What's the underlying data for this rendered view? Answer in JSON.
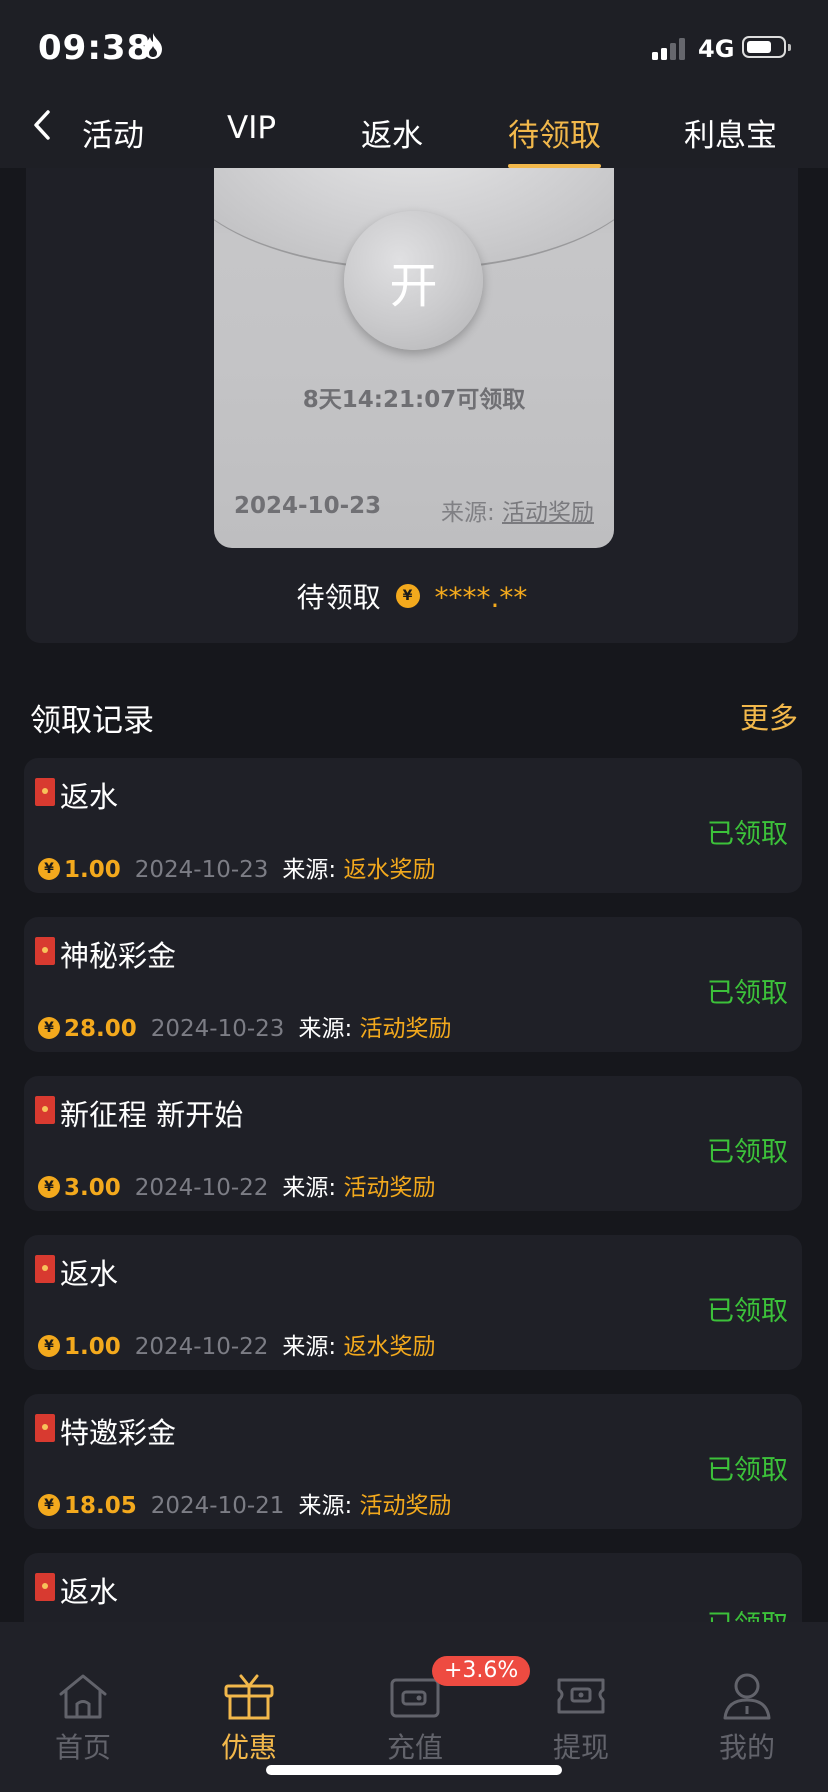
{
  "status_bar": {
    "time": "09:38",
    "network": "4G"
  },
  "tabs": [
    {
      "label": "活动"
    },
    {
      "label": "VIP"
    },
    {
      "label": "返水"
    },
    {
      "label": "待领取"
    },
    {
      "label": "利息宝"
    }
  ],
  "active_tab": "待领取",
  "envelope": {
    "open_label": "开",
    "countdown": "8天14:21:07可领取",
    "date": "2024-10-23",
    "source_label": "来源:",
    "source": "活动奖励"
  },
  "pending": {
    "label": "待领取",
    "currency_symbol": "¥",
    "amount_masked": "****.**"
  },
  "records_section": {
    "title": "领取记录",
    "more": "更多"
  },
  "records": [
    {
      "name": "返水",
      "status": "已领取",
      "amount": "1.00",
      "date": "2024-10-23",
      "source_label": "来源:",
      "source": "返水奖励"
    },
    {
      "name": "神秘彩金",
      "status": "已领取",
      "amount": "28.00",
      "date": "2024-10-23",
      "source_label": "来源:",
      "source": "活动奖励"
    },
    {
      "name": "新征程 新开始",
      "status": "已领取",
      "amount": "3.00",
      "date": "2024-10-22",
      "source_label": "来源:",
      "source": "活动奖励"
    },
    {
      "name": "返水",
      "status": "已领取",
      "amount": "1.00",
      "date": "2024-10-22",
      "source_label": "来源:",
      "source": "返水奖励"
    },
    {
      "name": "特邀彩金",
      "status": "已领取",
      "amount": "18.05",
      "date": "2024-10-21",
      "source_label": "来源:",
      "source": "活动奖励"
    },
    {
      "name": "返水",
      "status": "已领取"
    }
  ],
  "bottom_nav": [
    {
      "label": "首页",
      "icon": "home-icon"
    },
    {
      "label": "优惠",
      "icon": "gift-icon"
    },
    {
      "label": "充值",
      "icon": "wallet-icon"
    },
    {
      "label": "提现",
      "icon": "withdraw-icon"
    },
    {
      "label": "我的",
      "icon": "user-icon"
    }
  ],
  "recharge_badge": "+3.6%",
  "colors": {
    "accent": "#f2b84b",
    "claimed": "#3cc13a",
    "coin": "#f3a91d",
    "background": "#16171c",
    "card": "#1f2027"
  }
}
